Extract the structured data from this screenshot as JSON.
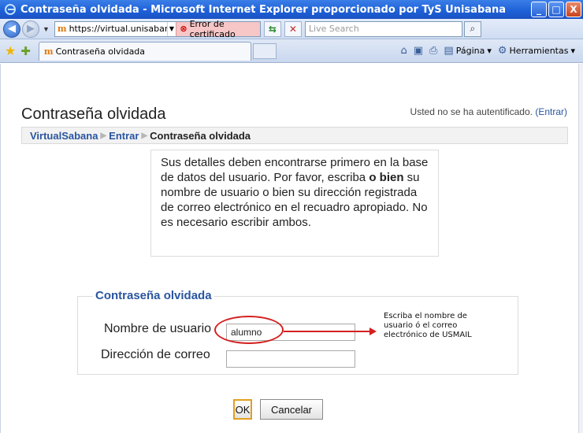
{
  "window": {
    "title": "Contraseña olvidada - Microsoft Internet Explorer proporcionado por TyS Unisabana",
    "minimize": "_",
    "maximize": "□",
    "close": "X"
  },
  "addressbar": {
    "url": "https://virtual.unisabana.edu",
    "cert_error": "Error de certificado",
    "search_placeholder": "Live Search"
  },
  "tabs": [
    {
      "label": "Contraseña olvidada"
    }
  ],
  "commandbar": {
    "page_label": "Página",
    "tools_label": "Herramientas"
  },
  "page": {
    "title": "Contraseña olvidada",
    "login_status": "Usted no se ha autentificado.",
    "login_link": "(Entrar)"
  },
  "breadcrumb": {
    "items": [
      {
        "label": "VirtualSabana"
      },
      {
        "label": "Entrar"
      }
    ],
    "current": "Contraseña olvidada",
    "separator": "▶"
  },
  "instructions": {
    "part1": "Sus detalles deben encontrarse primero en la base de datos del usuario. Por favor, escriba ",
    "bold": "o bien",
    "part2": " su nombre de usuario o bien su dirección registrada de correo electrónico en el recuadro apropiado. No es necesario escribir ambos."
  },
  "form": {
    "legend": "Contraseña olvidada",
    "username_label": "Nombre de usuario",
    "username_value": "alumno",
    "email_label": "Dirección de correo",
    "email_value": "",
    "ok_label": "OK",
    "cancel_label": "Cancelar"
  },
  "annotation": {
    "text": "Escriba el nombre de usuario ó el correo electrónico de USMAIL",
    "color": "#d42020"
  },
  "icons": {
    "back": "back-arrow-icon",
    "forward": "forward-arrow-icon",
    "refresh": "refresh-icon",
    "stop": "stop-icon",
    "search": "search-icon",
    "favorites": "favorites-star-icon",
    "add_favorites": "add-favorites-icon",
    "home": "home-icon",
    "feeds": "feeds-icon",
    "print": "print-icon"
  }
}
